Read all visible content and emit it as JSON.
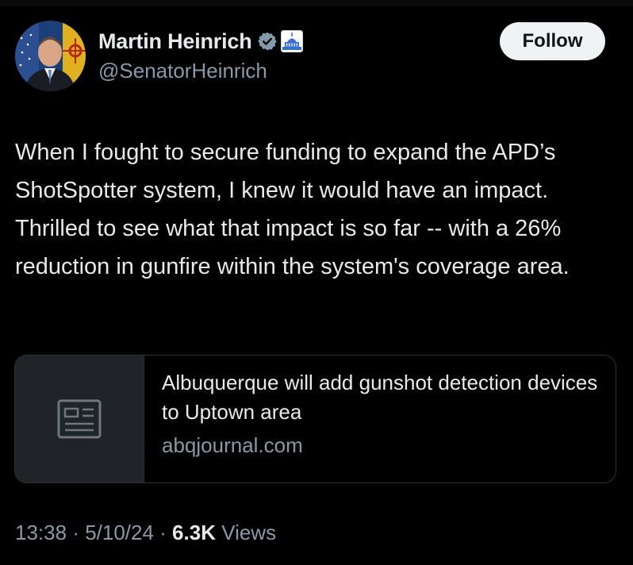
{
  "author": {
    "display_name": "Martin Heinrich",
    "handle": "@SenatorHeinrich",
    "avatar_icon": "profile-photo",
    "verified_icon": "verified-badge-icon",
    "affiliation_icon": "us-capitol-icon"
  },
  "follow_button": {
    "label": "Follow"
  },
  "tweet": {
    "text": "When I fought to secure funding to expand the APD’s ShotSpotter system, I knew it would have an impact. Thrilled to see what that impact is so far -- with a 26% reduction in gunfire within the system's coverage area."
  },
  "link_card": {
    "title": "Albuquerque will add gunshot detection devices to Uptown area",
    "domain": "abqjournal.com",
    "thumbnail_icon": "news-article-icon"
  },
  "meta": {
    "time": "13:38",
    "separator": " · ",
    "date": "5/10/24",
    "views_count": "6.3K",
    "views_label": " Views"
  },
  "colors": {
    "background": "#000000",
    "text": "#e7e9ea",
    "secondary_text": "#8b98a5",
    "verified": "#829aab",
    "follow_bg": "#eff3f4",
    "card_border": "#2f3336",
    "card_thumb_bg": "#202327"
  }
}
